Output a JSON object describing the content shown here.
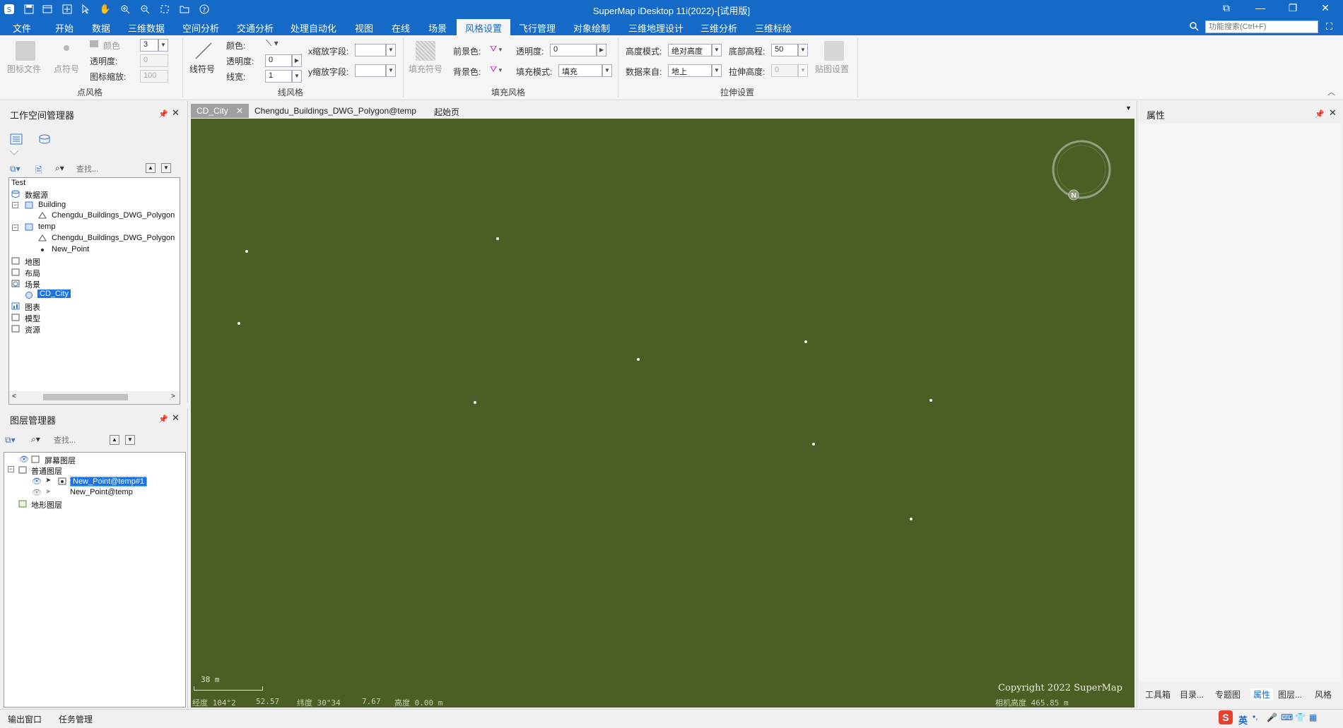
{
  "app": {
    "title": "SuperMap iDesktop 11i(2022)-[试用版]"
  },
  "menu": {
    "file": "文件",
    "start": "开始",
    "data": "数据",
    "data3d": "三维数据",
    "spatial": "空间分析",
    "traffic": "交通分析",
    "automation": "处理自动化",
    "view": "视图",
    "online": "在线",
    "scene": "场景",
    "style": "风格设置",
    "flight": "飞行管理",
    "objdraw": "对象绘制",
    "geodesign": "三维地理设计",
    "analysis3d": "三维分析",
    "annotation3d": "三维标绘"
  },
  "search": {
    "placeholder": "功能搜索(Ctrl+F)"
  },
  "ribbon": {
    "point_style": {
      "icon_file": "图标文件",
      "point_symbol": "点符号",
      "color": "颜色",
      "size_value": "3",
      "opacity": "透明度:",
      "opacity_value": "0",
      "icon_scale": "图标缩放:",
      "icon_scale_value": "100",
      "group_title": "点风格"
    },
    "line_style": {
      "line_symbol": "线符号",
      "color": "颜色:",
      "opacity": "透明度:",
      "opacity_value": "0",
      "width": "线宽:",
      "width_value": "1",
      "x_scale_field": "x缩放字段:",
      "y_scale_field": "y缩放字段:",
      "group_title": "线风格"
    },
    "fill_style": {
      "fill_symbol": "填充符号",
      "fore_color": "前景色:",
      "back_color": "背景色:",
      "opacity": "透明度:",
      "opacity_value": "0",
      "fill_mode": "填充模式:",
      "fill_mode_value": "填充",
      "group_title": "填充风格"
    },
    "extrude": {
      "height_mode": "高度模式:",
      "height_mode_value": "绝对高度",
      "bottom_alt": "底部高程:",
      "bottom_alt_value": "50",
      "data_source": "数据来自:",
      "data_source_value": "地上",
      "extrude_height": "拉伸高度:",
      "extrude_height_value": "0",
      "texture": "贴图设置",
      "group_title": "拉伸设置"
    }
  },
  "workspace": {
    "title": "工作空间管理器",
    "search_placeholder": "查找...",
    "tree": {
      "root": "Test",
      "datasources": "数据源",
      "building": "Building",
      "building_poly": "Chengdu_Buildings_DWG_Polygon",
      "temp": "temp",
      "temp_poly": "Chengdu_Buildings_DWG_Polygon",
      "new_point": "New_Point",
      "maps": "地图",
      "layouts": "布局",
      "scenes": "场景",
      "cd_city": "CD_City",
      "charts": "图表",
      "models": "模型",
      "resources": "资源"
    }
  },
  "layers": {
    "title": "图层管理器",
    "search_placeholder": "查找...",
    "screen_layers": "屏幕图层",
    "normal_layers": "普通图层",
    "layer1": "New_Point@temp#1",
    "layer2": "New_Point@temp",
    "terrain_layers": "地形图层"
  },
  "tabs": {
    "cd_city": "CD_City",
    "polygon_temp": "Chengdu_Buildings_DWG_Polygon@temp",
    "start_page": "起始页"
  },
  "scene": {
    "compass_label": "N",
    "scale_text": "38 m",
    "copyright": "Copyright 2022 SuperMap",
    "status_lon": "经度 104°2",
    "status_lon2": "52.57",
    "status_lat": "纬度 30°34",
    "status_lat2": "7.67",
    "status_alt": "高度 0.00 m",
    "status_camera": "相机高度 465.85 m"
  },
  "properties": {
    "title": "属性"
  },
  "right_tabs": {
    "toolbox": "工具箱",
    "catalog": "目录...",
    "thematic": "专题图",
    "properties": "属性",
    "layers": "图层...",
    "style": "风格"
  },
  "bottom": {
    "output": "输出窗口",
    "tasks": "任务管理"
  },
  "ime": {
    "lang": "英"
  },
  "colors": {
    "accent": "#1569c7",
    "scene_bg": "#4b5e24",
    "selection": "#1a73e8"
  }
}
